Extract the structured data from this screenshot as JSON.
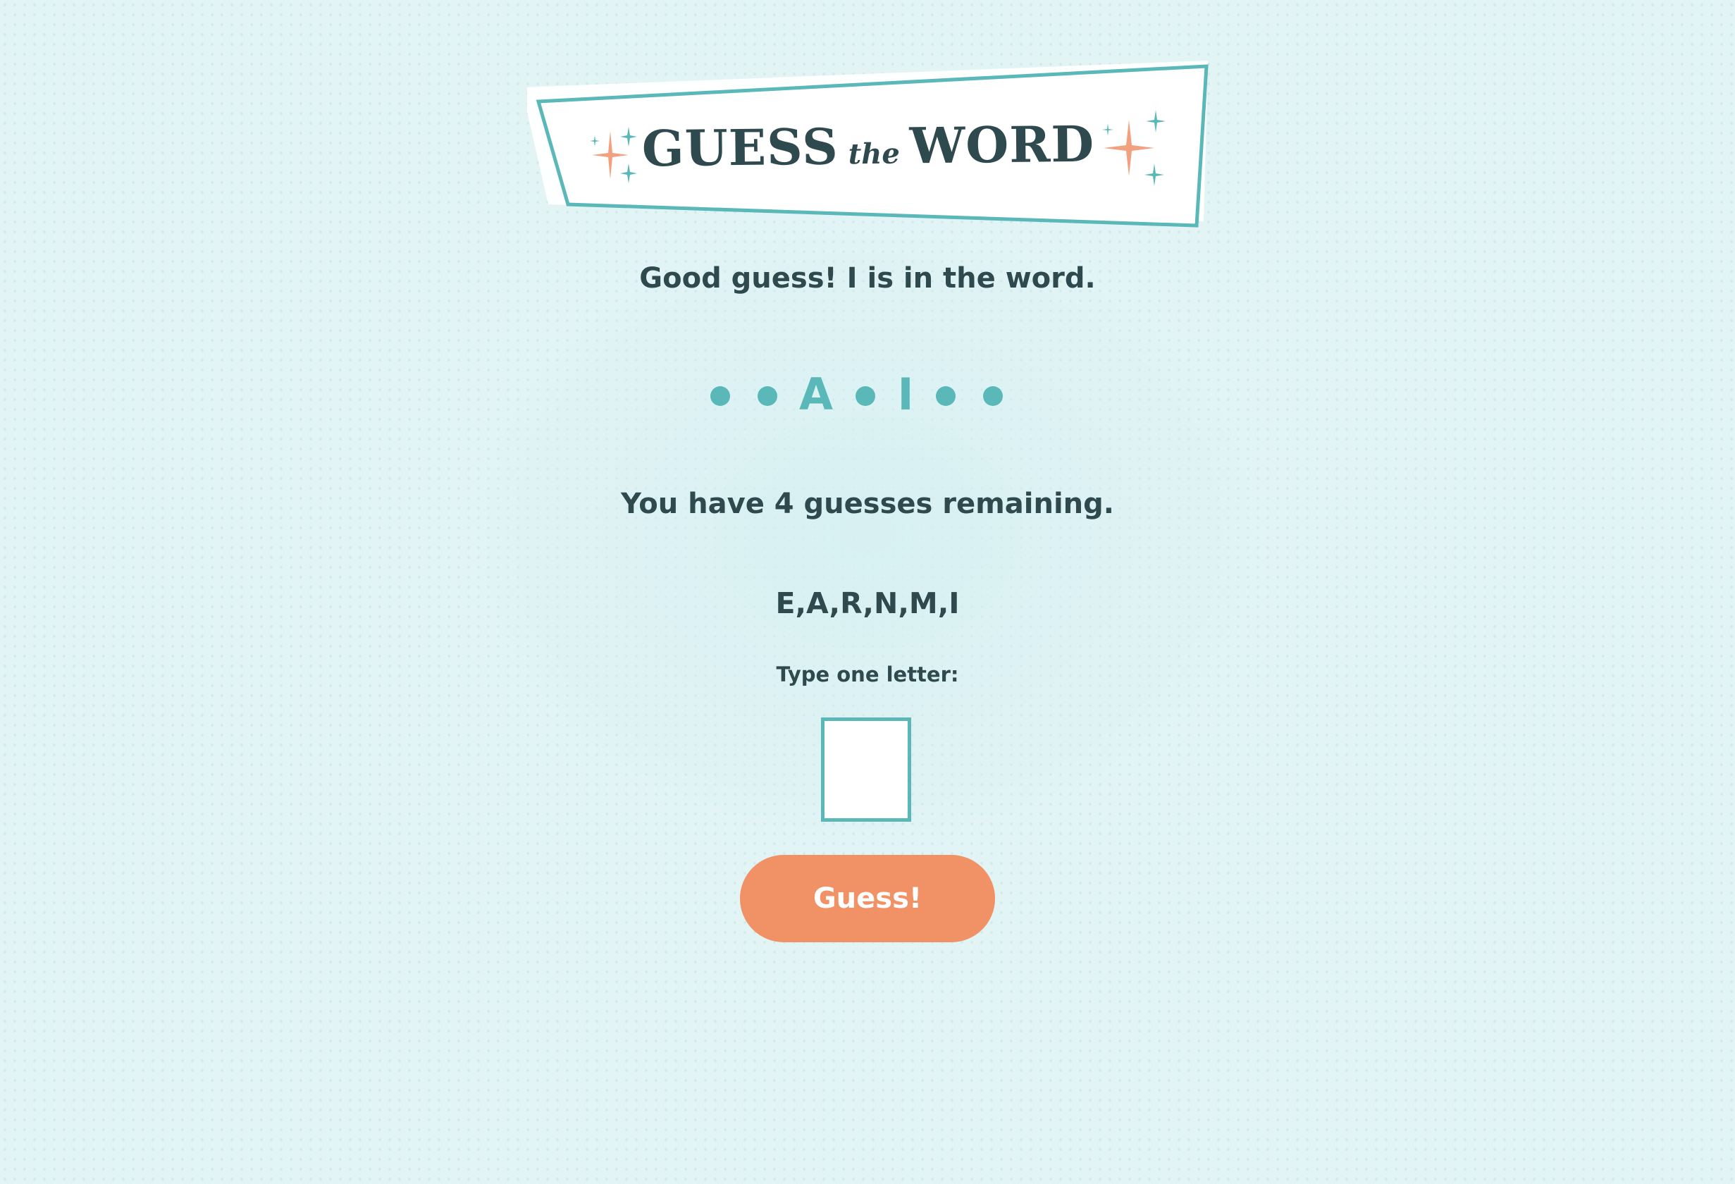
{
  "logo": {
    "word1": "GUESS",
    "the": "the",
    "word2": "WORD"
  },
  "message": "Good guess! I is in the word.",
  "word_progress": [
    "●",
    "●",
    "A",
    "●",
    "I",
    "●",
    "●"
  ],
  "remaining_text": "You have 4 guesses remaining.",
  "guessed_letters": "E,A,R,N,M,I",
  "prompt": {
    "label": "Type one letter:",
    "value": ""
  },
  "button": {
    "label": "Guess!"
  },
  "colors": {
    "accent_teal": "#5bb8b9",
    "button_orange": "#f19166",
    "text_dark": "#2f4a4e",
    "sparkle_orange": "#f2a07e",
    "background": "#e3f4f5"
  }
}
